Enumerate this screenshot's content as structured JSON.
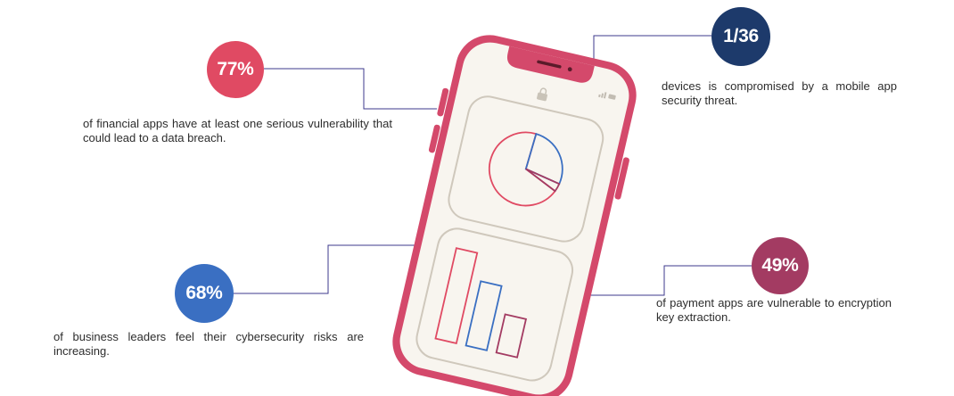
{
  "stats": [
    {
      "value": "77%",
      "text": "of financial apps have at least one serious vulnerability that could lead to a data breach.",
      "color": "#e04a63"
    },
    {
      "value": "1/36",
      "text": "devices is compromised by a mobile app security threat.",
      "color": "#1d3a6b"
    },
    {
      "value": "68%",
      "text": "of business leaders feel their cybersecurity risks are increasing.",
      "color": "#3a6fc2"
    },
    {
      "value": "49%",
      "text": "of payment apps are vulnerable to encryption key extraction.",
      "color": "#a33b62"
    }
  ],
  "colors": {
    "phone_frame": "#d4496b",
    "phone_screen": "#f8f5ef",
    "card_stroke": "#cfc8bc",
    "chart_red": "#e04a63",
    "chart_blue": "#3a6fc2",
    "chart_wine": "#a33b62",
    "connector": "#3d3a8c"
  },
  "icons": {
    "lock": "lock-icon",
    "status": "status-icons"
  }
}
